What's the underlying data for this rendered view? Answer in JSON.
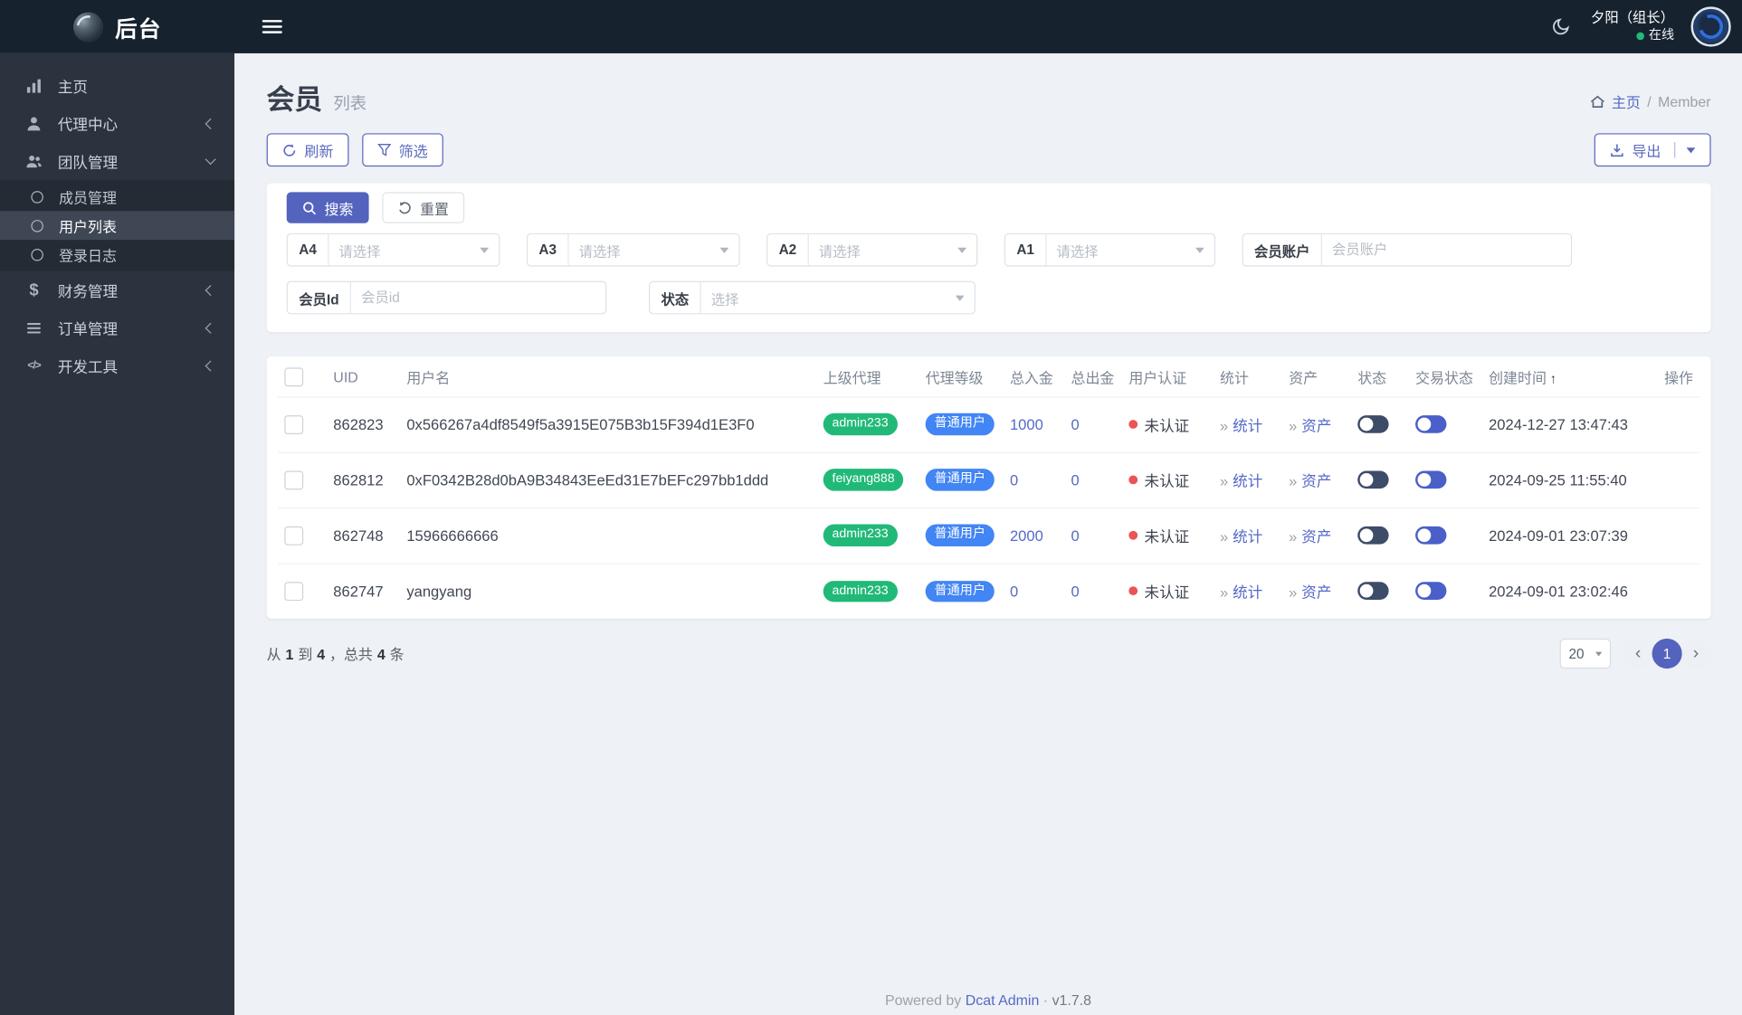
{
  "topbar": {
    "logo_text": "后台",
    "user_name": "夕阳（组长）",
    "user_status": "在线"
  },
  "sidebar": {
    "items": [
      {
        "label": "主页"
      },
      {
        "label": "代理中心"
      },
      {
        "label": "团队管理"
      },
      {
        "label": "财务管理"
      },
      {
        "label": "订单管理"
      },
      {
        "label": "开发工具"
      }
    ],
    "team_children": [
      {
        "label": "成员管理"
      },
      {
        "label": "用户列表"
      },
      {
        "label": "登录日志"
      }
    ]
  },
  "page": {
    "title": "会员",
    "subtitle": "列表",
    "breadcrumb_home": "主页",
    "breadcrumb_sep": "/",
    "breadcrumb_current": "Member"
  },
  "toolbar": {
    "refresh_label": "刷新",
    "filter_label": "筛选",
    "export_label": "导出"
  },
  "filters": {
    "search_label": "搜索",
    "reset_label": "重置",
    "a4_label": "A4",
    "a4_placeholder": "请选择",
    "a3_label": "A3",
    "a3_placeholder": "请选择",
    "a2_label": "A2",
    "a2_placeholder": "请选择",
    "a1_label": "A1",
    "a1_placeholder": "请选择",
    "account_label": "会员账户",
    "account_placeholder": "会员账户",
    "member_id_label": "会员Id",
    "member_id_placeholder": "会员id",
    "status_label": "状态",
    "status_placeholder": "选择"
  },
  "table": {
    "columns": {
      "uid": "UID",
      "username": "用户名",
      "agent": "上级代理",
      "level": "代理等级",
      "deposit": "总入金",
      "withdraw": "总出金",
      "auth": "用户认证",
      "stats": "统计",
      "assets": "资产",
      "status": "状态",
      "trade_status": "交易状态",
      "created": "创建时间",
      "actions": "操作"
    },
    "rows": [
      {
        "uid": "862823",
        "username": "0x566267a4df8549f5a3915E075B3b15F394d1E3F0",
        "agent": "admin233",
        "level": "普通用户",
        "deposit": "1000",
        "withdraw": "0",
        "auth": "未认证",
        "stats": "统计",
        "assets": "资产",
        "created": "2024-12-27 13:47:43"
      },
      {
        "uid": "862812",
        "username": "0xF0342B28d0bA9B34843EeEd31E7bEFc297bb1ddd",
        "agent": "feiyang888",
        "level": "普通用户",
        "deposit": "0",
        "withdraw": "0",
        "auth": "未认证",
        "stats": "统计",
        "assets": "资产",
        "created": "2024-09-25 11:55:40"
      },
      {
        "uid": "862748",
        "username": "15966666666",
        "agent": "admin233",
        "level": "普通用户",
        "deposit": "2000",
        "withdraw": "0",
        "auth": "未认证",
        "stats": "统计",
        "assets": "资产",
        "created": "2024-09-01 23:07:39"
      },
      {
        "uid": "862747",
        "username": "yangyang",
        "agent": "admin233",
        "level": "普通用户",
        "deposit": "0",
        "withdraw": "0",
        "auth": "未认证",
        "stats": "统计",
        "assets": "资产",
        "created": "2024-09-01 23:02:46"
      }
    ]
  },
  "pagination": {
    "summary_from_label": "从",
    "summary_from": "1",
    "summary_to_label": "到",
    "summary_to": "4",
    "summary_total_label": "，总共",
    "summary_total": "4",
    "summary_unit": "条",
    "page_size": "20",
    "current_page": "1"
  },
  "footer": {
    "powered_by": "Powered by",
    "brand": "Dcat Admin",
    "separator": "·",
    "version": "v1.7.8"
  },
  "colors": {
    "primary": "#5463be",
    "link": "#5569c8",
    "success_badge": "#21b978",
    "info_badge": "#4285f4",
    "danger": "#ea5455"
  }
}
